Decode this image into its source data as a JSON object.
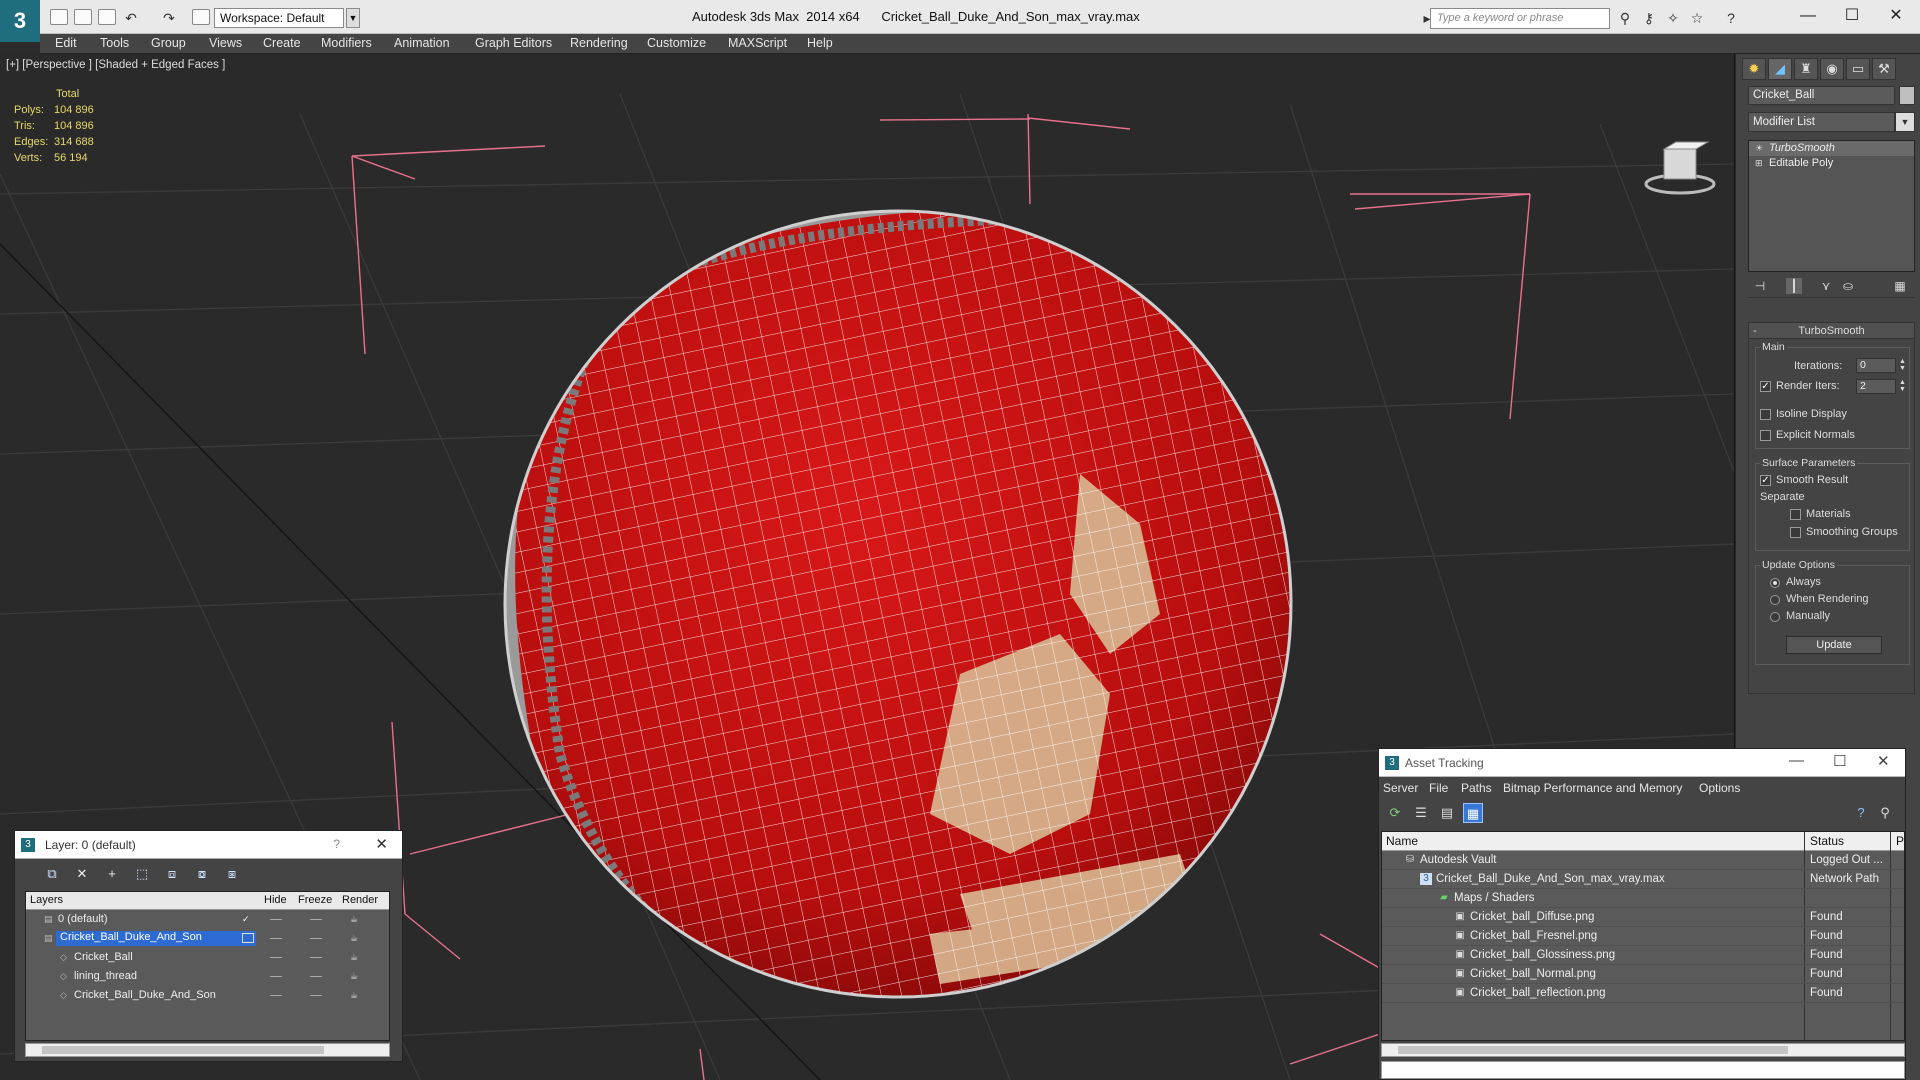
{
  "titlebar": {
    "workspace_label": "Workspace: Default",
    "window_title": "Autodesk 3ds Max  2014 x64      Cricket_Ball_Duke_And_Son_max_vray.max",
    "search_placeholder": "Type a keyword or phrase"
  },
  "menu": [
    "Edit",
    "Tools",
    "Group",
    "Views",
    "Create",
    "Modifiers",
    "Animation",
    "Graph Editors",
    "Rendering",
    "Customize",
    "MAXScript",
    "Help"
  ],
  "viewport": {
    "label": "[+] [Perspective ] [Shaded + Edged Faces ]",
    "stats": {
      "header": "Total",
      "rows": [
        {
          "key": "Polys:",
          "value": "104 896"
        },
        {
          "key": "Tris:",
          "value": "104 896"
        },
        {
          "key": "Edges:",
          "value": "314 688"
        },
        {
          "key": "Verts:",
          "value": "56 194"
        }
      ]
    },
    "colors": {
      "ball": "#c01010",
      "wire": "#ffffff",
      "bbox": "#e8728e",
      "seam": "#8a8a8a",
      "logo": "#d8b690"
    }
  },
  "command_panel": {
    "object_name": "Cricket_Ball",
    "modifier_list": "Modifier List",
    "stack": [
      {
        "label": "TurboSmooth",
        "active": true
      },
      {
        "label": "Editable Poly",
        "active": false
      }
    ],
    "turbosmooth": {
      "title": "TurboSmooth",
      "main_group": "Main",
      "iterations_label": "Iterations:",
      "iterations_value": "0",
      "render_iters_label": "Render Iters:",
      "render_iters_value": "2",
      "render_iters_checked": true,
      "isoline_label": "Isoline Display",
      "explicit_normals_label": "Explicit Normals",
      "surface_group": "Surface Parameters",
      "smooth_result_label": "Smooth Result",
      "separate_label": "Separate",
      "materials_label": "Materials",
      "smoothing_groups_label": "Smoothing Groups",
      "update_group": "Update Options",
      "always_label": "Always",
      "when_rendering_label": "When Rendering",
      "manually_label": "Manually",
      "update_button": "Update"
    }
  },
  "layer_dialog": {
    "title": "Layer: 0 (default)",
    "help": "?",
    "columns": {
      "layers": "Layers",
      "hide": "Hide",
      "freeze": "Freeze",
      "render": "Render"
    },
    "rows": [
      {
        "name": "0 (default)",
        "indent": 0,
        "selected": false
      },
      {
        "name": "Cricket_Ball_Duke_And_Son",
        "indent": 0,
        "selected": true
      },
      {
        "name": "Cricket_Ball",
        "indent": 1,
        "selected": false
      },
      {
        "name": "lining_thread",
        "indent": 1,
        "selected": false
      },
      {
        "name": "Cricket_Ball_Duke_And_Son",
        "indent": 1,
        "selected": false
      }
    ]
  },
  "asset_dialog": {
    "title": "Asset Tracking",
    "menu": [
      "Server",
      "File",
      "Paths",
      "Bitmap Performance and Memory",
      "Options"
    ],
    "columns": {
      "name": "Name",
      "status": "Status",
      "extra": "P"
    },
    "rows": [
      {
        "name": "Autodesk Vault",
        "status": "Logged Out ...",
        "indent": 0
      },
      {
        "name": "Cricket_Ball_Duke_And_Son_max_vray.max",
        "status": "Network Path",
        "indent": 1
      },
      {
        "name": "Maps / Shaders",
        "status": "",
        "indent": 2
      },
      {
        "name": "Cricket_ball_Diffuse.png",
        "status": "Found",
        "indent": 3
      },
      {
        "name": "Cricket_ball_Fresnel.png",
        "status": "Found",
        "indent": 3
      },
      {
        "name": "Cricket_ball_Glossiness.png",
        "status": "Found",
        "indent": 3
      },
      {
        "name": "Cricket_ball_Normal.png",
        "status": "Found",
        "indent": 3
      },
      {
        "name": "Cricket_ball_reflection.png",
        "status": "Found",
        "indent": 3
      }
    ]
  }
}
